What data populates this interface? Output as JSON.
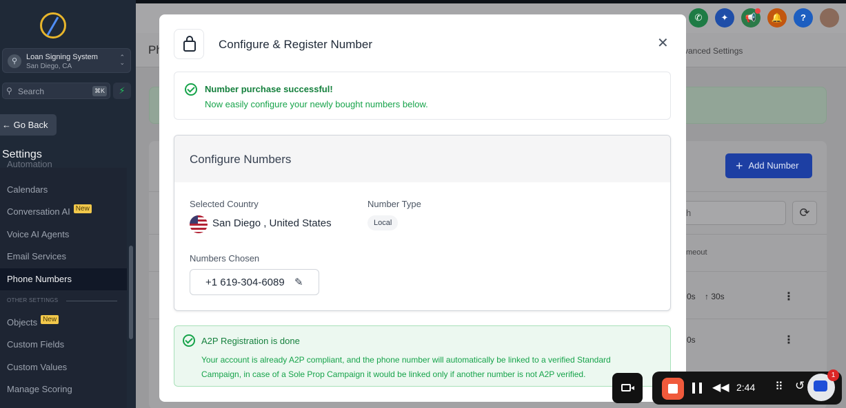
{
  "sidebar": {
    "account": {
      "name": "Loan Signing System",
      "location": "San Diego, CA"
    },
    "search": {
      "placeholder": "Search",
      "shortcut": "⌘K"
    },
    "go_back": "← Go Back",
    "section_title": "Settings",
    "items": [
      {
        "label": "Automation"
      },
      {
        "label": "Calendars"
      },
      {
        "label": "Conversation AI",
        "badge": "New"
      },
      {
        "label": "Voice AI Agents"
      },
      {
        "label": "Email Services"
      },
      {
        "label": "Phone Numbers",
        "active": true
      }
    ],
    "other_settings_label": "OTHER SETTINGS",
    "other_items": [
      {
        "label": "Objects",
        "badge": "New"
      },
      {
        "label": "Custom Fields"
      },
      {
        "label": "Custom Values"
      },
      {
        "label": "Manage Scoring"
      }
    ]
  },
  "background": {
    "page_title": "Ph",
    "advanced_settings_tab": "vanced Settings",
    "add_number_button": "Add Number",
    "search_partial": "h",
    "timeout_header": "meout",
    "row1": {
      "a": "0s",
      "b": "↑ 30s"
    },
    "row2": {
      "a": "0s"
    },
    "top_icons": [
      {
        "name": "phone",
        "color": "#1e7b45"
      },
      {
        "name": "sparkle",
        "color": "#1f4ea8"
      },
      {
        "name": "megaphone",
        "color": "#2b7a48"
      },
      {
        "name": "bell",
        "color": "#c2560f"
      },
      {
        "name": "help",
        "color": "#1d5ec0"
      }
    ]
  },
  "modal": {
    "title": "Configure & Register Number",
    "success": {
      "title": "Number purchase successful!",
      "message": "Now easily configure your newly bought numbers below."
    },
    "configure": {
      "heading": "Configure Numbers",
      "country_label": "Selected Country",
      "country_value": "San Diego , United States",
      "type_label": "Number Type",
      "type_value": "Local",
      "numbers_label": "Numbers Chosen",
      "number": "+1 619-304-6089"
    },
    "a2p": {
      "title": "A2P Registration is done",
      "message": "Your account is already A2P compliant, and the phone number will automatically be linked to a verified Standard Campaign, in case of a Sole Prop Campaign it would be linked only if another number is not A2P verified."
    }
  },
  "recorder": {
    "time": "2:44",
    "notification_count": "1"
  }
}
